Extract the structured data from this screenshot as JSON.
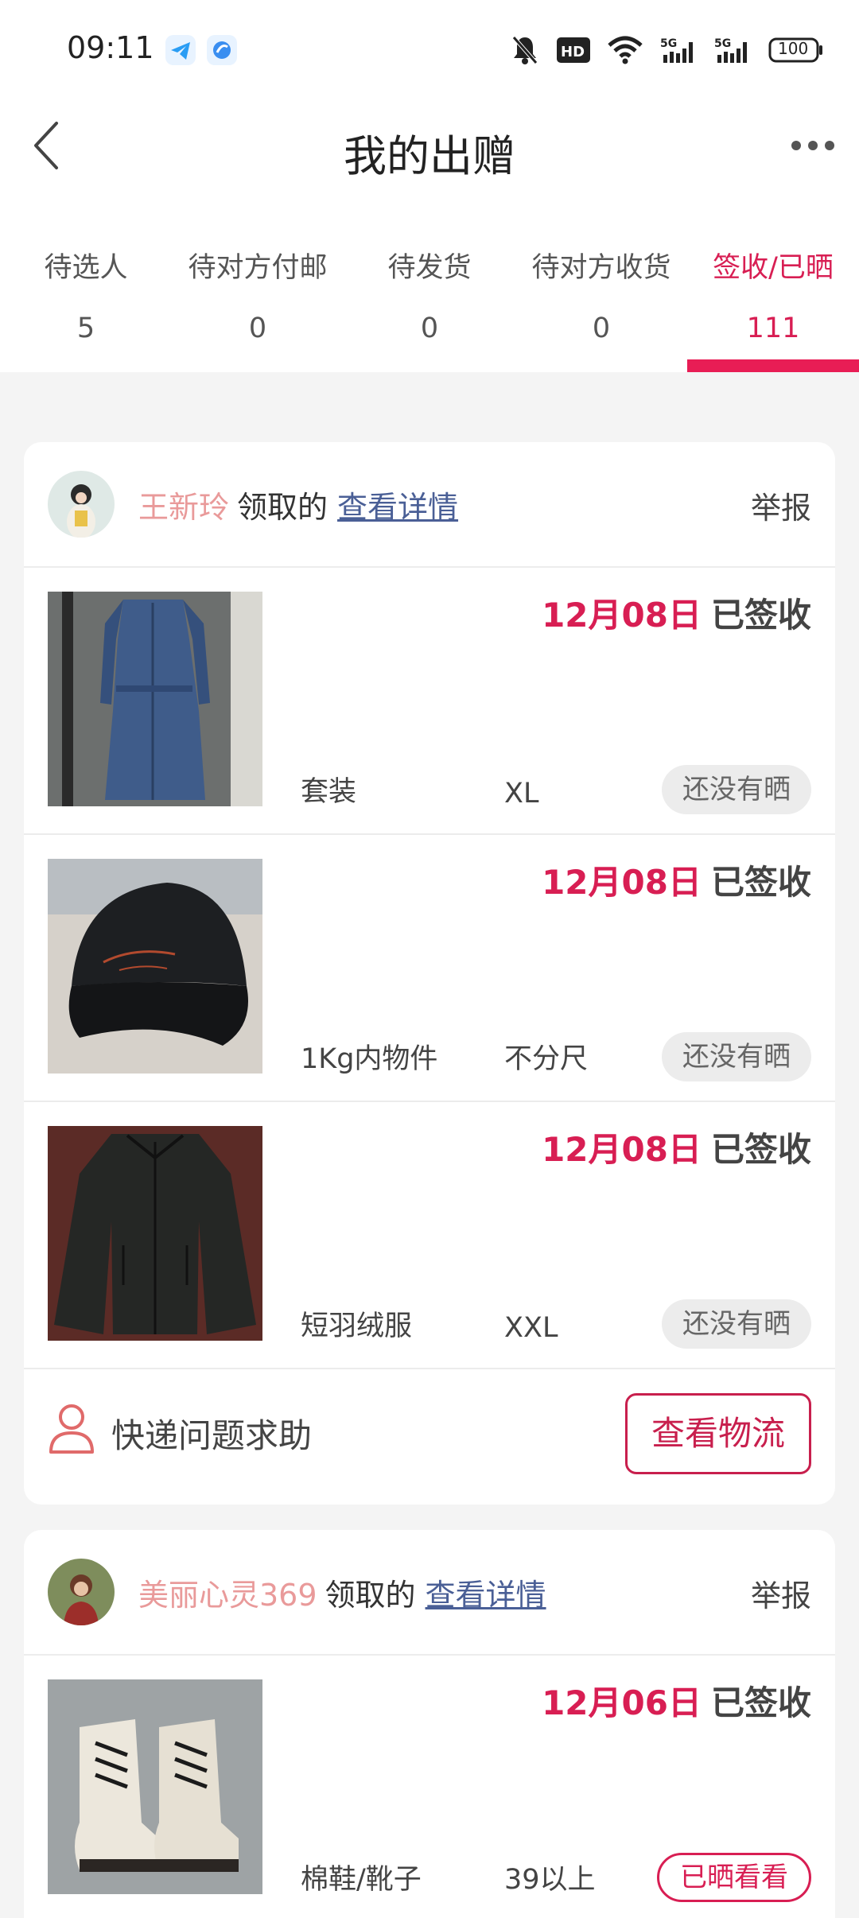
{
  "status_bar": {
    "time": "09:11",
    "battery": "100",
    "icons": [
      "telegram-icon",
      "app-icon",
      "mute-icon",
      "hd-icon",
      "wifi-icon",
      "signal-5g-icon",
      "signal-5g-icon",
      "battery-icon"
    ]
  },
  "header": {
    "title": "我的出赠",
    "back_icon": "chevron-left-icon",
    "more_icon": "more-icon"
  },
  "tabs": [
    {
      "label": "待选人",
      "count": "5"
    },
    {
      "label": "待对方付邮",
      "count": "0"
    },
    {
      "label": "待发货",
      "count": "0"
    },
    {
      "label": "待对方收货",
      "count": "0"
    },
    {
      "label": "签收/已晒",
      "count": "111",
      "active": true
    }
  ],
  "colors": {
    "accent": "#d81e53",
    "claimer": "#e99a9a",
    "link": "#4a5f96",
    "background": "#f4f4f4"
  },
  "cards": [
    {
      "claimer": "王新玲",
      "claimed_word": "领取的",
      "detail_link": "查看详情",
      "report": "举报",
      "items": [
        {
          "date": "12月08日",
          "state": "已签收",
          "name": "套装",
          "size": "XL",
          "badge": "还没有晒",
          "thumb": "denim-jumpsuit"
        },
        {
          "date": "12月08日",
          "state": "已签收",
          "name": "1Kg内物件",
          "size": "不分尺",
          "badge": "还没有晒",
          "thumb": "black-cap"
        },
        {
          "date": "12月08日",
          "state": "已签收",
          "name": "短羽绒服",
          "size": "XXL",
          "badge": "还没有晒",
          "thumb": "black-jacket"
        }
      ],
      "footer": {
        "help_text": "快递问题求助",
        "help_icon": "person-icon",
        "button": "查看物流"
      }
    },
    {
      "claimer": "美丽心灵369",
      "claimed_word": "领取的",
      "detail_link": "查看详情",
      "report": "举报",
      "items": [
        {
          "date": "12月06日",
          "state": "已签收",
          "name": "棉鞋/靴子",
          "size": "39以上",
          "badge": "已晒看看",
          "thumb": "white-boots"
        }
      ]
    }
  ]
}
